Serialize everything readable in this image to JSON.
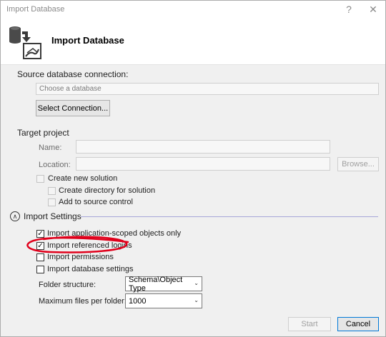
{
  "window": {
    "title": "Import Database",
    "help_glyph": "?",
    "close_glyph": "✕"
  },
  "header": {
    "title": "Import Database",
    "icon": "import-database-icon"
  },
  "source": {
    "label": "Source database connection:",
    "connection_placeholder": "Choose a database",
    "select_button": "Select Connection..."
  },
  "target": {
    "label": "Target project",
    "name_label": "Name:",
    "name_value": "",
    "location_label": "Location:",
    "location_value": "",
    "browse_button": "Browse...",
    "create_solution": {
      "label": "Create new solution",
      "checked": false
    },
    "create_directory": {
      "label": "Create directory for solution",
      "checked": false
    },
    "source_control": {
      "label": "Add to source control",
      "checked": false
    }
  },
  "import_settings": {
    "label": "Import Settings",
    "expanded": true,
    "options": [
      {
        "label": "Import application-scoped objects only",
        "checked": true
      },
      {
        "label": "Import referenced logins",
        "checked": true
      },
      {
        "label": "Import permissions",
        "checked": false
      },
      {
        "label": "Import database settings",
        "checked": false
      }
    ],
    "folder_structure_label": "Folder structure:",
    "folder_structure_value": "Schema\\Object Type",
    "max_files_label": "Maximum files per folder:",
    "max_files_value": "1000"
  },
  "footer": {
    "start_button": "Start",
    "cancel_button": "Cancel"
  },
  "colors": {
    "annotation": "#e0001b",
    "divider": "#a6a6d8"
  }
}
